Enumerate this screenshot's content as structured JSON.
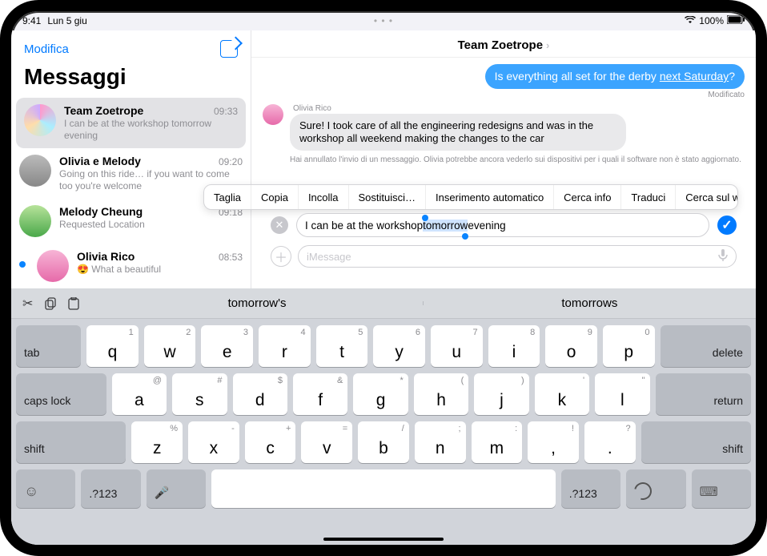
{
  "status": {
    "time": "9:41",
    "date": "Lun 5 giu",
    "battery": "100%"
  },
  "sidebar": {
    "edit": "Modifica",
    "title": "Messaggi",
    "items": [
      {
        "name": "Team Zoetrope",
        "time": "09:33",
        "preview": "I can be at the workshop tomorrow evening"
      },
      {
        "name": "Olivia e Melody",
        "time": "09:20",
        "preview": "Going on this ride… if you want to come too you're welcome"
      },
      {
        "name": "Melody Cheung",
        "time": "09:18",
        "preview": "Requested Location"
      },
      {
        "name": "Olivia Rico",
        "time": "08:53",
        "preview": "😍 What a beautiful"
      }
    ]
  },
  "chat": {
    "title": "Team Zoetrope",
    "out_prefix": "Is everything all set for the derby ",
    "out_underlined": "next Saturday",
    "out_suffix": "?",
    "edited": "Modificato",
    "in_name": "Olivia Rico",
    "in_text": "Sure! I took care of all the engineering redesigns and was in the workshop all weekend making the changes to the car",
    "system": "Hai annullato l'invio di un messaggio. Olivia potrebbe ancora vederlo sui dispositivi per i quali il software non è stato aggiornato."
  },
  "context": [
    "Taglia",
    "Copia",
    "Incolla",
    "Sostituisci…",
    "Inserimento automatico",
    "Cerca info",
    "Traduci",
    "Cerca sul web"
  ],
  "edit_field": {
    "pre": "I can be at the workshop ",
    "sel": "tomorrow",
    "post": " evening"
  },
  "compose": {
    "placeholder": "iMessage"
  },
  "predictions": [
    "tomorrow's",
    "tomorrows"
  ],
  "keys": {
    "row1_alts": [
      "1",
      "2",
      "3",
      "4",
      "5",
      "6",
      "7",
      "8",
      "9",
      "0"
    ],
    "row1": [
      "q",
      "w",
      "e",
      "r",
      "t",
      "y",
      "u",
      "i",
      "o",
      "p"
    ],
    "row2_alts": [
      "@",
      "#",
      "$",
      "&",
      "*",
      "(",
      ")",
      "'",
      "\""
    ],
    "row2": [
      "a",
      "s",
      "d",
      "f",
      "g",
      "h",
      "j",
      "k",
      "l"
    ],
    "row3_alts": [
      "%",
      "-",
      "+",
      "=",
      "/",
      ";",
      ":",
      "!",
      "?"
    ],
    "row3": [
      "z",
      "x",
      "c",
      "v",
      "b",
      "n",
      "m",
      ",",
      "."
    ],
    "tab": "tab",
    "delete": "delete",
    "caps": "caps lock",
    "return": "return",
    "shift": "shift",
    "numsym": ".?123"
  }
}
